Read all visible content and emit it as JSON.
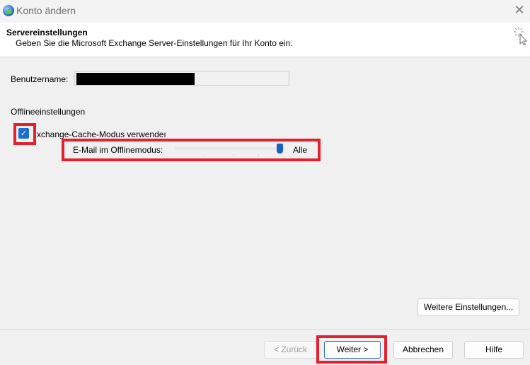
{
  "window": {
    "title": "Konto ändern",
    "close_glyph": "✕",
    "app_icon": "outlook-globe-icon"
  },
  "header": {
    "title": "Servereinstellungen",
    "subtitle": "Geben Sie die Microsoft Exchange Server-Einstellungen für Ihr Konto ein.",
    "icon": "sparkle-cursor-icon"
  },
  "form": {
    "username_label": "Benutzername:",
    "username_value": "",
    "offline_section": "Offlineeinstellungen",
    "cached_mode_label": "xchange-Cache-Modus verwendeı",
    "cached_mode_checked": true,
    "mail_offline_label": "E-Mail im Offlinemodus:",
    "mail_offline_value": "Alle",
    "mail_offline_level": 1.0
  },
  "buttons": {
    "more_settings": "Weitere Einstellungen...",
    "back": "< Zurück",
    "next": "Weiter >",
    "cancel": "Abbrechen",
    "help": "Hilfe"
  },
  "colors": {
    "highlight": "#e5202e",
    "accent": "#1a6fd1"
  }
}
